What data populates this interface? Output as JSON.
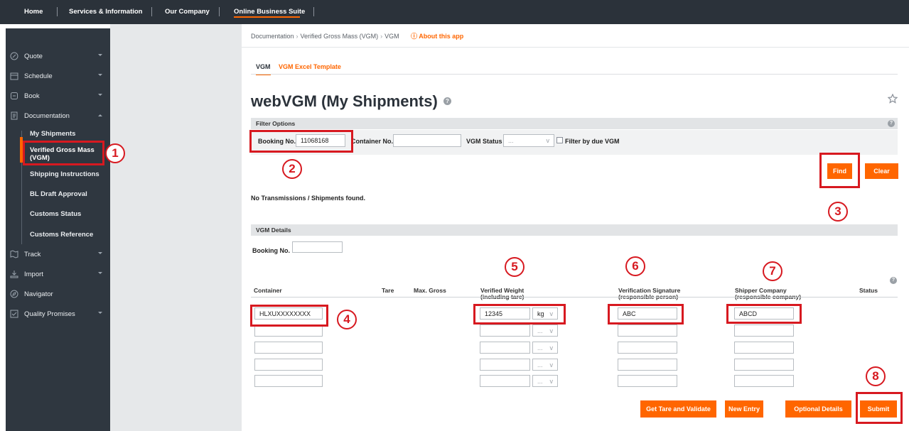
{
  "topnav": {
    "items": [
      "Home",
      "Services & Information",
      "Our Company",
      "Online Business Suite"
    ]
  },
  "sidebar": {
    "items": [
      {
        "label": "Quote",
        "icon": "tag-icon"
      },
      {
        "label": "Schedule",
        "icon": "calendar-icon"
      },
      {
        "label": "Book",
        "icon": "book-icon"
      },
      {
        "label": "Documentation",
        "icon": "document-icon"
      },
      {
        "label": "Track",
        "icon": "map-icon"
      },
      {
        "label": "Import",
        "icon": "import-icon"
      },
      {
        "label": "Navigator",
        "icon": "compass-icon"
      },
      {
        "label": "Quality Promises",
        "icon": "quality-icon"
      }
    ],
    "subitems": [
      "My Shipments",
      "Verified Gross Mass",
      "(VGM)",
      "Shipping Instructions",
      "BL Draft Approval",
      "Customs Status",
      "Customs Reference"
    ]
  },
  "breadcrumb": [
    "Documentation",
    "Verified Gross Mass (VGM)",
    "VGM"
  ],
  "about_link": "About this app",
  "tabs": [
    "VGM",
    "VGM Excel Template"
  ],
  "page_title": "webVGM (My Shipments)",
  "filter": {
    "section_label": "Filter Options",
    "booking_label": "Booking No.",
    "booking_value": "11068168",
    "container_label": "Container No.",
    "container_value": "",
    "vgm_status_label": "VGM Status",
    "vgm_status_value": "...",
    "due_label": "Filter by due VGM"
  },
  "buttons": {
    "find": "Find",
    "clear": "Clear",
    "get_tare": "Get Tare and Validate",
    "new_entry": "New Entry",
    "optional_details": "Optional Details",
    "submit": "Submit"
  },
  "no_results": "No Transmissions / Shipments found.",
  "details": {
    "section_label": "VGM Details",
    "booking_label": "Booking No.",
    "booking_value": "",
    "columns": {
      "container": "Container",
      "tare": "Tare",
      "max_gross": "Max. Gross",
      "verified_weight": "Verified Weight",
      "verified_weight_sub": "(including tare)",
      "signature": "Verification Signature",
      "signature_sub": "(responsible person)",
      "shipper": "Shipper Company",
      "shipper_sub": "(responsible company)",
      "status": "Status"
    },
    "rows": [
      {
        "container": "HLXUXXXXXXXX",
        "weight": "12345",
        "unit": "kg",
        "signature": "ABC",
        "shipper": "ABCD"
      },
      {
        "container": "",
        "weight": "",
        "unit": "...",
        "signature": "",
        "shipper": ""
      },
      {
        "container": "",
        "weight": "",
        "unit": "...",
        "signature": "",
        "shipper": ""
      },
      {
        "container": "",
        "weight": "",
        "unit": "...",
        "signature": "",
        "shipper": ""
      },
      {
        "container": "",
        "weight": "",
        "unit": "...",
        "signature": "",
        "shipper": ""
      }
    ]
  },
  "annotations": [
    "1",
    "2",
    "3",
    "4",
    "5",
    "6",
    "7",
    "8"
  ],
  "colors": {
    "accent": "#ff6600",
    "annotation": "#d71920",
    "nav": "#2b323a"
  }
}
